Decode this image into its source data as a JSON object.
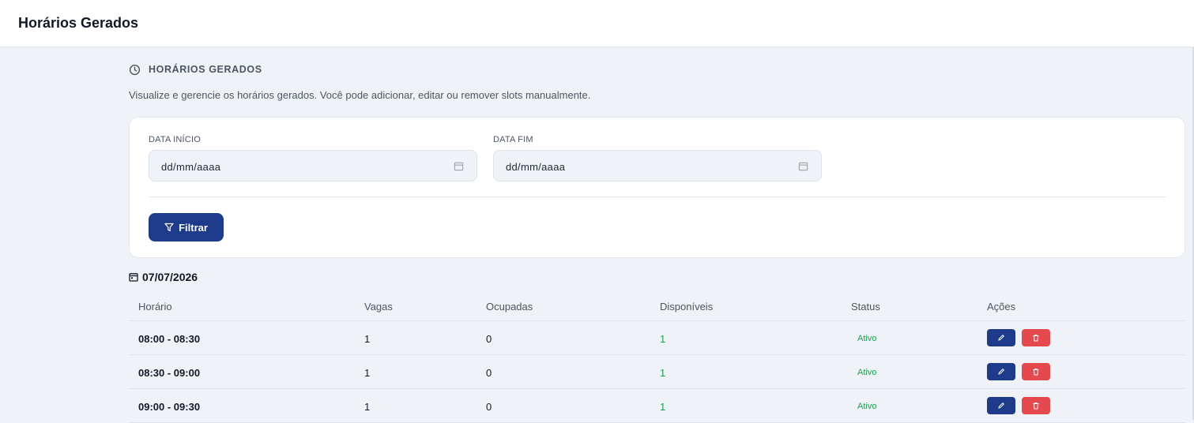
{
  "header": {
    "title": "Horários Gerados"
  },
  "section": {
    "icon": "clock-icon",
    "heading": "HORÁRIOS GERADOS",
    "description": "Visualize e gerencie os horários gerados. Você pode adicionar, editar ou remover slots manualmente."
  },
  "filters": {
    "start": {
      "label": "DATA INÍCIO",
      "value": "dd/mm/aaaa",
      "icon": "calendar-icon"
    },
    "end": {
      "label": "DATA FIM",
      "value": "dd/mm/aaaa",
      "icon": "calendar-icon"
    },
    "button_label": "Filtrar",
    "button_icon": "filter-icon"
  },
  "day": {
    "date": "07/07/2026",
    "icon": "calendar-icon"
  },
  "table": {
    "columns": [
      "Horário",
      "Vagas",
      "Ocupadas",
      "Disponíveis",
      "Status",
      "Ações"
    ],
    "rows": [
      {
        "time": "08:00 - 08:30",
        "slots": "1",
        "taken": "0",
        "available": "1",
        "status": "Ativo"
      },
      {
        "time": "08:30 - 09:00",
        "slots": "1",
        "taken": "0",
        "available": "1",
        "status": "Ativo"
      },
      {
        "time": "09:00 - 09:30",
        "slots": "1",
        "taken": "0",
        "available": "1",
        "status": "Ativo"
      }
    ]
  },
  "colors": {
    "primary": "#1e3a8a",
    "danger": "#e5484d",
    "success": "#16a34a",
    "background": "#eff3f8"
  }
}
